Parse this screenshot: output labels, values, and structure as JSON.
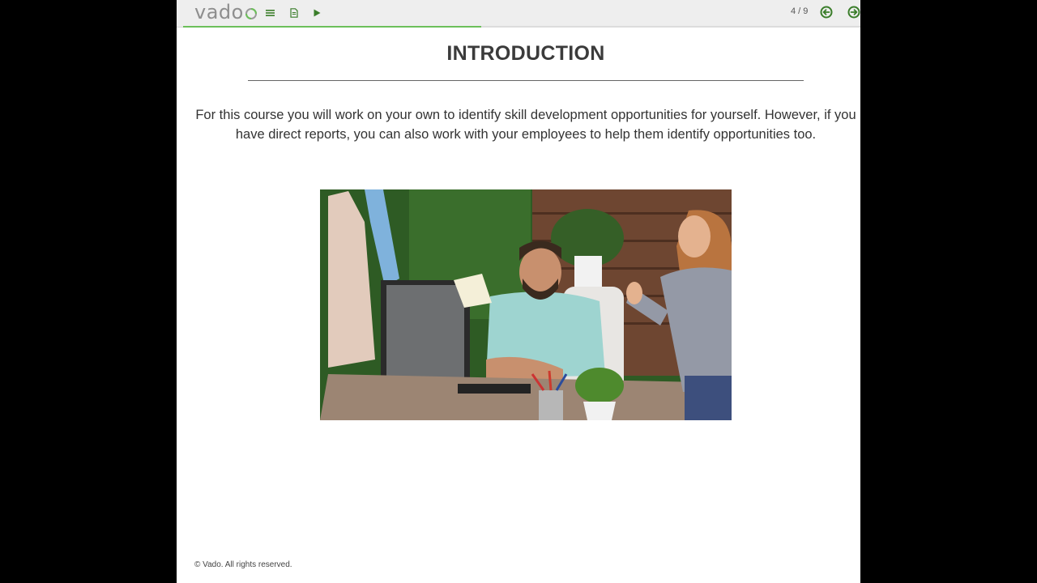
{
  "app": {
    "logo_text": "vado"
  },
  "toolbar": {
    "menu_icon": "menu-icon",
    "notes_icon": "document-icon",
    "play_icon": "play-icon",
    "page_counter": "4 / 9",
    "prev_icon": "arrow-left-circle-icon",
    "next_icon": "arrow-right-circle-icon",
    "progress": 0.44
  },
  "slide": {
    "title": "INTRODUCTION",
    "body": "For this course you will work on your own to identify skill development opportunities for yourself. However, if you have direct reports, you can also work with your employees to help them identify opportunities too."
  },
  "footer": {
    "copyright": "© Vado. All rights reserved."
  },
  "colors": {
    "accent": "#3a7d2a",
    "progress": "#6cbf5a"
  }
}
